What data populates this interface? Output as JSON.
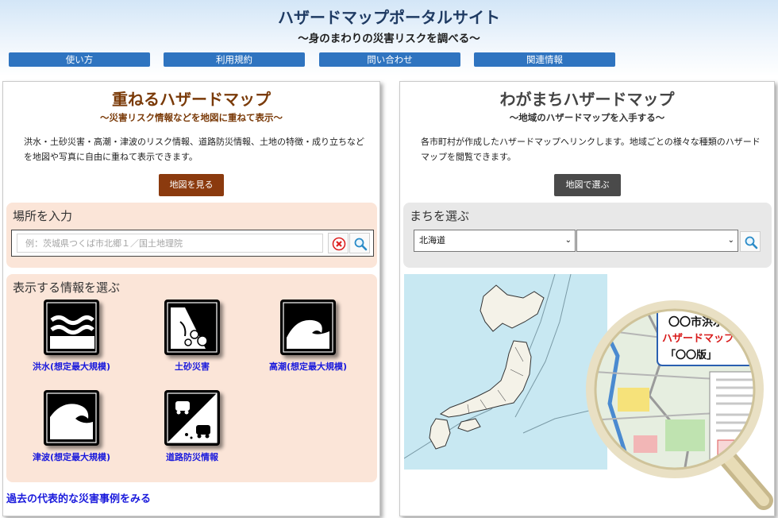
{
  "header": {
    "title": "ハザードマップポータルサイト",
    "subtitle": "～身のまわりの災害リスクを調べる～"
  },
  "nav": [
    {
      "label": "使い方"
    },
    {
      "label": "利用規約"
    },
    {
      "label": "問い合わせ"
    },
    {
      "label": "関連情報"
    }
  ],
  "left": {
    "title": "重ねるハザードマップ",
    "subtitle": "～災害リスク情報などを地図に重ねて表示～",
    "description": "洪水・土砂災害・高潮・津波のリスク情報、道路防災情報、土地の特徴・成り立ちなどを地図や写真に自由に重ねて表示できます。",
    "map_button": "地図を見る",
    "search": {
      "title": "場所を入力",
      "placeholder": "例：茨城県つくば市北郷１／国土地理院",
      "value": ""
    },
    "info": {
      "title": "表示する情報を選ぶ",
      "items": [
        {
          "label": "洪水(想定最大規模)",
          "icon": "flood-icon"
        },
        {
          "label": "土砂災害",
          "icon": "landslide-icon"
        },
        {
          "label": "高潮(想定最大規模)",
          "icon": "storm-surge-icon"
        },
        {
          "label": "津波(想定最大規模)",
          "icon": "tsunami-icon"
        },
        {
          "label": "道路防災情報",
          "icon": "road-disaster-icon"
        }
      ]
    },
    "past_link": "過去の代表的な災害事例をみる"
  },
  "right": {
    "title": "わがまちハザードマップ",
    "subtitle": "～地域のハザードマップを入手する～",
    "description": "各市町村が作成したハザードマップへリンクします。地域ごとの様々な種類のハザードマップを閲覧できます。",
    "map_button": "地図で選ぶ",
    "town": {
      "title": "まちを選ぶ",
      "prefecture": "北海道",
      "city": ""
    },
    "magnifier": {
      "line1": "〇〇市洪水",
      "line2": "ハザードマップ",
      "line3": "「〇〇版」"
    }
  },
  "colors": {
    "nav_button": "#2f74c0",
    "left_title": "#7a3a08",
    "left_button": "#8b3a0e",
    "right_button": "#4a4a4a",
    "left_box": "#fbe5d8",
    "right_box": "#e8e8e8",
    "link": "#1a1adc",
    "sea": "#c8e8f2"
  }
}
